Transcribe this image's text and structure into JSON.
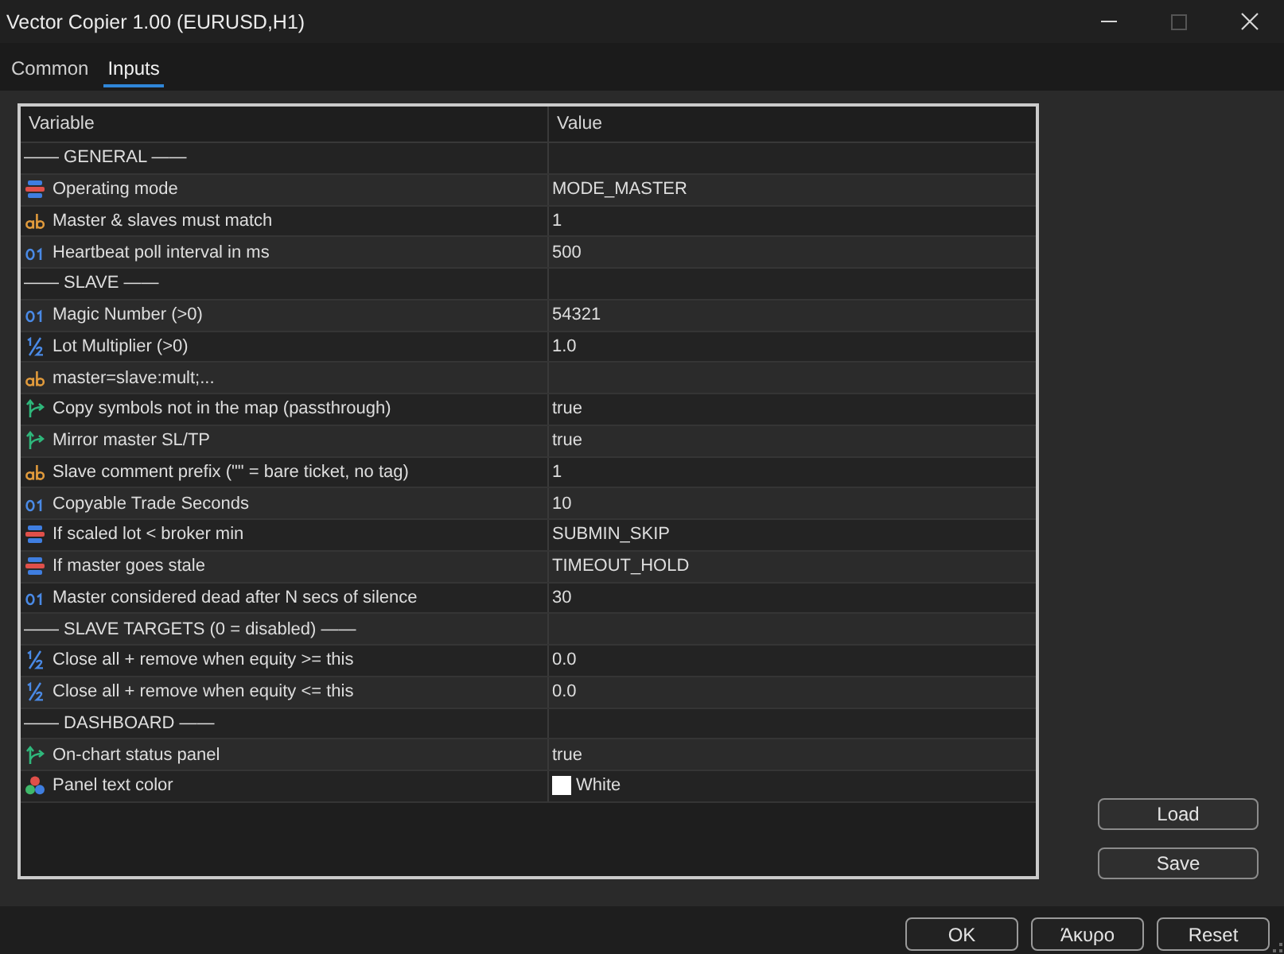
{
  "window": {
    "title": "Vector Copier 1.00 (EURUSD,H1)",
    "maximize_disabled": true
  },
  "tabs": [
    {
      "label": "Common",
      "selected": false
    },
    {
      "label": "Inputs",
      "selected": true
    }
  ],
  "table": {
    "columns": [
      "Variable",
      "Value"
    ],
    "rows": [
      {
        "kind": "section",
        "variable": "—— GENERAL ——"
      },
      {
        "kind": "enum",
        "variable": "Operating mode",
        "value": "MODE_MASTER"
      },
      {
        "kind": "string",
        "variable": "Master & slaves must match",
        "value": "1"
      },
      {
        "kind": "integer",
        "variable": "Heartbeat poll interval in ms",
        "value": "500"
      },
      {
        "kind": "section",
        "variable": "—— SLAVE ——"
      },
      {
        "kind": "integer",
        "variable": "Magic Number (>0)",
        "value": "54321"
      },
      {
        "kind": "double",
        "variable": "Lot Multiplier (>0)",
        "value": "1.0"
      },
      {
        "kind": "string",
        "variable": "master=slave:mult;..."
      },
      {
        "kind": "bool",
        "variable": "Copy symbols not in the map (passthrough)",
        "value": "true"
      },
      {
        "kind": "bool",
        "variable": "Mirror master SL/TP",
        "value": "true"
      },
      {
        "kind": "string",
        "variable": "Slave comment prefix (\"\" = bare ticket, no tag)",
        "value": "1"
      },
      {
        "kind": "integer",
        "variable": "Copyable Trade Seconds",
        "value": "10"
      },
      {
        "kind": "enum",
        "variable": "If scaled lot < broker min",
        "value": "SUBMIN_SKIP"
      },
      {
        "kind": "enum",
        "variable": "If master goes stale",
        "value": "TIMEOUT_HOLD"
      },
      {
        "kind": "integer",
        "variable": "Master considered dead after N secs of silence",
        "value": "30"
      },
      {
        "kind": "section",
        "variable": "—— SLAVE TARGETS (0 = disabled) ——"
      },
      {
        "kind": "double",
        "variable": "Close all + remove when equity >= this",
        "value": "0.0"
      },
      {
        "kind": "double",
        "variable": "Close all + remove when equity <= this",
        "value": "0.0"
      },
      {
        "kind": "section",
        "variable": "—— DASHBOARD ——"
      },
      {
        "kind": "bool",
        "variable": "On-chart status panel",
        "value": "true"
      },
      {
        "kind": "color",
        "variable": "Panel text color",
        "value": "White",
        "color": "#ffffff"
      }
    ]
  },
  "side_buttons": [
    "Load",
    "Save"
  ],
  "footer_buttons": [
    "OK",
    "Άκυρο",
    "Reset"
  ]
}
